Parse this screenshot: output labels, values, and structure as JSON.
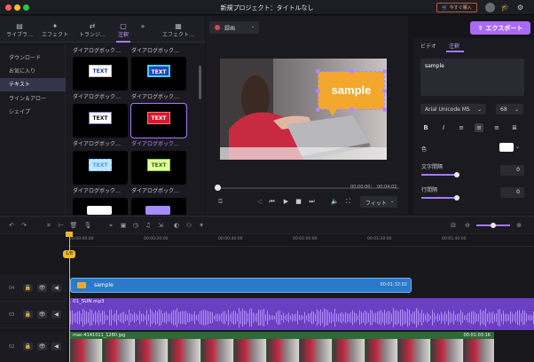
{
  "window": {
    "title": "新規プロジェクト：タイトルなし",
    "buy_label": "今すぐ購入"
  },
  "media_tabs": [
    {
      "label": "ライブラ…",
      "icon": "library-icon"
    },
    {
      "label": "エフェクト",
      "icon": "effect-icon"
    },
    {
      "label": "トランジ…",
      "icon": "transition-icon"
    },
    {
      "label": "注釈",
      "icon": "annotation-icon"
    },
    {
      "label": "エフェクト…",
      "icon": "effect-presets-icon"
    }
  ],
  "categories": [
    "ダウンロード",
    "お気に入り",
    "テキスト",
    "ライン＆アロー",
    "シェイプ"
  ],
  "active_category": "テキスト",
  "grid": {
    "row0_labels": [
      "ダイアログボック…",
      "ダイアログボック…"
    ],
    "items": [
      {
        "label": "ダイアログボック…",
        "text": "TEXT"
      },
      {
        "label": "ダイアログボック…",
        "text": "TEXT"
      },
      {
        "label": "ダイアログボック…",
        "text": "TEXT"
      },
      {
        "label": "ダイアログボック…",
        "text": "TEXT"
      },
      {
        "label": "ダイアログボック…",
        "text": "TEXT"
      },
      {
        "label": "ダイアログボック…",
        "text": "TEXT"
      }
    ]
  },
  "preview": {
    "quality_label": "録画",
    "overlay_text": "sample",
    "current_time": "00:00:00",
    "total_time": "00:04:02",
    "fit_label": "フィット"
  },
  "export_label": "エクスポート",
  "properties": {
    "tabs": [
      "ビデオ",
      "注釈"
    ],
    "active_tab": "注釈",
    "text_value": "sample",
    "font": "Arial Unicode MS",
    "font_size": "68",
    "color_label": "色",
    "char_spacing_label": "文字間隔",
    "char_spacing_value": "0",
    "line_spacing_label": "行間隔",
    "line_spacing_value": "0"
  },
  "timeline": {
    "ruler_ticks": [
      "00:00:00:00",
      "00:00:20:00",
      "00:00:40:00",
      "00:01:00:00",
      "00:01:20:00",
      "00:01:40:00"
    ],
    "tracks": [
      {
        "number": "04"
      },
      {
        "number": "03"
      },
      {
        "number": "02"
      }
    ],
    "clips": {
      "sample": {
        "label": "sample",
        "duration": "00:01:32:02"
      },
      "audio": {
        "label": "01_SUN.mp3"
      },
      "video": {
        "label": "mac-4141011_1280.jpg",
        "duration": "00:01:03:16"
      }
    },
    "playhead_label": "1/8"
  },
  "colors": {
    "accent": "#a779ff",
    "export": "#a96bf4",
    "playhead": "#f0b928",
    "overlay_bubble": "#f3a72c",
    "text_clip": "#2b7ac9",
    "audio_clip": "#6a3fc2",
    "video_clip": "#2d6a35"
  }
}
